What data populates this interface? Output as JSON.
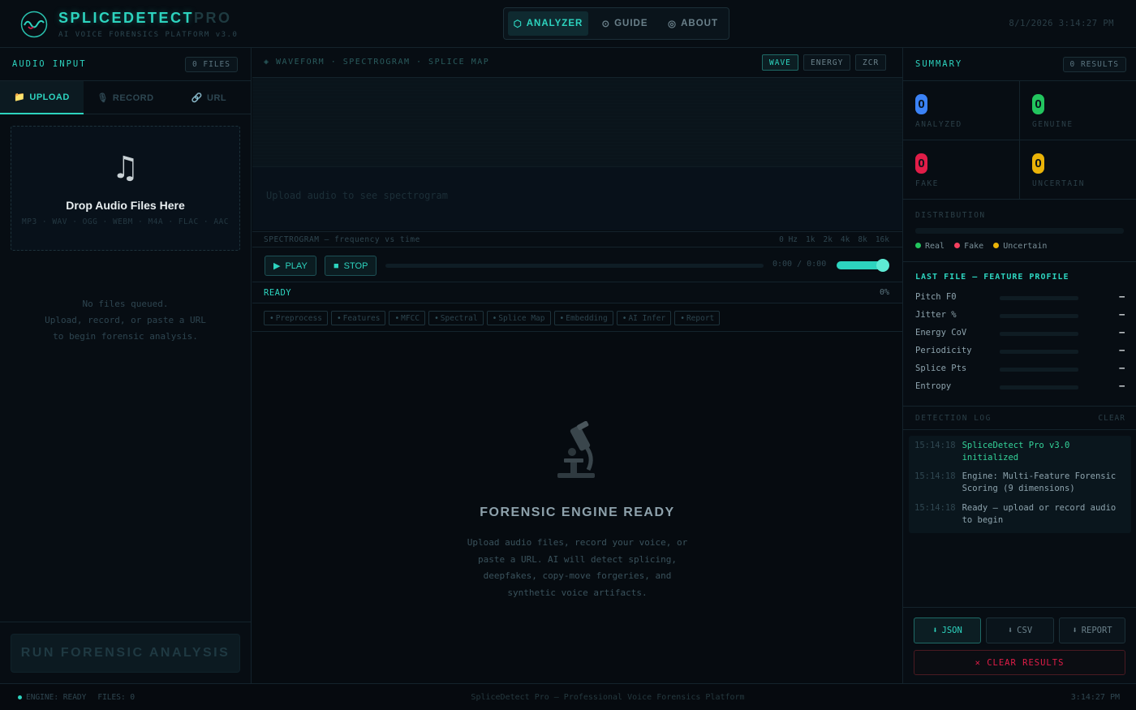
{
  "header": {
    "brand_main": "SPLICEDETECT",
    "brand_suffix": "PRO",
    "subtitle": "AI VOICE FORENSICS PLATFORM v3.0",
    "nav": [
      {
        "icon": "⬡",
        "label": "ANALYZER",
        "active": true
      },
      {
        "icon": "⊙",
        "label": "GUIDE",
        "active": false
      },
      {
        "icon": "◎",
        "label": "ABOUT",
        "active": false
      }
    ],
    "datetime": "8/1/2026 3:14:27 PM"
  },
  "left_panel": {
    "title": "AUDIO INPUT",
    "files_badge": "0 FILES",
    "tabs": [
      {
        "icon": "📁",
        "label": "UPLOAD",
        "active": true
      },
      {
        "icon": "🎙",
        "label": "RECORD",
        "active": false
      },
      {
        "icon": "🔗",
        "label": "URL",
        "active": false
      }
    ],
    "dropzone": {
      "icon": "♫",
      "title": "Drop Audio Files Here",
      "formats": "MP3 · WAV · OGG · WEBM · M4A · FLAC · AAC"
    },
    "empty_queue": [
      "No files queued.",
      "Upload, record, or paste a URL",
      "to begin forensic analysis."
    ],
    "run_button": "RUN FORENSIC ANALYSIS"
  },
  "center": {
    "viz_title": "◈ WAVEFORM · SPECTROGRAM · SPLICE MAP",
    "modes": [
      {
        "label": "WAVE",
        "active": true
      },
      {
        "label": "ENERGY",
        "active": false
      },
      {
        "label": "ZCR",
        "active": false
      }
    ],
    "spectrogram_placeholder": "Upload audio to see spectrogram",
    "spectrogram_caption": "SPECTROGRAM — frequency vs time",
    "freq_ticks": [
      "0 Hz",
      "1k",
      "2k",
      "4k",
      "8k",
      "16k"
    ],
    "transport": {
      "play": "PLAY",
      "stop": "STOP",
      "time": "0:00 / 0:00",
      "playback_progress": 0,
      "volume": 1.0
    },
    "status": "READY",
    "progress_pct": "0%",
    "stages": [
      "Preprocess",
      "Features",
      "MFCC",
      "Spectral",
      "Splice Map",
      "Embedding",
      "AI Infer",
      "Report"
    ],
    "empty_state": {
      "icon": "microscope-icon",
      "title": "FORENSIC ENGINE READY",
      "description": [
        "Upload audio files, record your voice, or",
        "paste a URL. AI will detect splicing,",
        "deepfakes, copy-move forgeries, and",
        "synthetic voice artifacts."
      ]
    }
  },
  "right_panel": {
    "title": "SUMMARY",
    "results_badge": "0 RESULTS",
    "stats": [
      {
        "value": "0",
        "label": "ANALYZED",
        "color": "#3b82f6"
      },
      {
        "value": "0",
        "label": "GENUINE",
        "color": "#22c55e"
      },
      {
        "value": "0",
        "label": "FAKE",
        "color": "#e11d48"
      },
      {
        "value": "0",
        "label": "UNCERTAIN",
        "color": "#eab308"
      }
    ],
    "distribution_title": "DISTRIBUTION",
    "legend": [
      {
        "label": "Real",
        "color": "#22c55e"
      },
      {
        "label": "Fake",
        "color": "#f43f5e"
      },
      {
        "label": "Uncertain",
        "color": "#eab308"
      }
    ],
    "feature_title": "LAST FILE — FEATURE PROFILE",
    "features": [
      {
        "name": "Pitch F0",
        "value": "—"
      },
      {
        "name": "Jitter %",
        "value": "—"
      },
      {
        "name": "Energy CoV",
        "value": "—"
      },
      {
        "name": "Periodicity",
        "value": "—"
      },
      {
        "name": "Splice Pts",
        "value": "—"
      },
      {
        "name": "Entropy",
        "value": "—"
      }
    ],
    "log_title": "DETECTION LOG",
    "log_clear": "CLEAR",
    "log": [
      {
        "time": "15:14:18",
        "message": "SpliceDetect Pro v3.0 initialized",
        "kind": "ok"
      },
      {
        "time": "15:14:18",
        "message": "Engine: Multi-Feature Forensic Scoring (9 dimensions)",
        "kind": "info"
      },
      {
        "time": "15:14:18",
        "message": "Ready — upload or record audio to begin",
        "kind": "info"
      }
    ],
    "exports": [
      {
        "icon": "⬇",
        "label": "JSON"
      },
      {
        "icon": "⬇",
        "label": "CSV"
      },
      {
        "icon": "⬇",
        "label": "REPORT"
      }
    ],
    "clear_results": "✕ CLEAR RESULTS"
  },
  "footer": {
    "engine": "ENGINE: READY",
    "files": "FILES: 0",
    "center": "SpliceDetect Pro — Professional Voice Forensics Platform",
    "time": "3:14:27 PM"
  },
  "colors": {
    "accent": "#2dd4bf",
    "background": "#060b10",
    "danger": "#e11d48",
    "success": "#34d399"
  }
}
